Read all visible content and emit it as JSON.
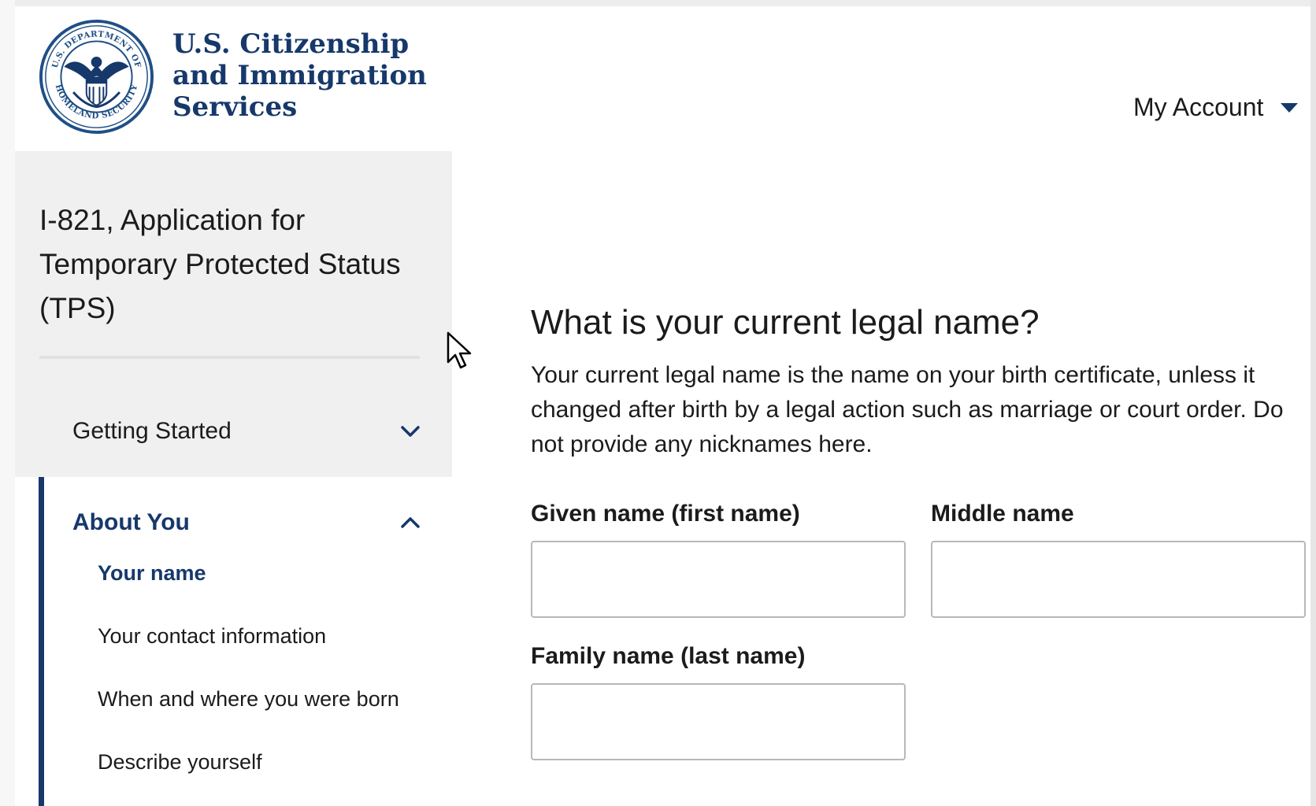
{
  "header": {
    "agency_name_lines": [
      "U.S. Citizenship",
      "and Immigration",
      "Services"
    ],
    "seal_ring_text": "U.S. DEPARTMENT OF HOMELAND SECURITY",
    "account_label": "My Account"
  },
  "sidebar": {
    "form_title": "I-821, Application for Temporary Protected Status (TPS)",
    "sections": [
      {
        "label": "Getting Started",
        "expanded": false
      },
      {
        "label": "About You",
        "expanded": true
      }
    ],
    "about_you_items": [
      {
        "label": "Your name",
        "current": true
      },
      {
        "label": "Your contact information",
        "current": false
      },
      {
        "label": "When and where you were born",
        "current": false
      },
      {
        "label": "Describe yourself",
        "current": false
      }
    ]
  },
  "main": {
    "question_title": "What is your current legal name?",
    "question_description": "Your current legal name is the name on your birth certificate, unless it changed after birth by a legal action such as marriage or court order. Do not provide any nicknames here.",
    "fields": {
      "given_name": {
        "label": "Given name (first name)",
        "value": ""
      },
      "middle_name": {
        "label": "Middle name",
        "value": ""
      },
      "family_name": {
        "label": "Family name (last name)",
        "value": ""
      }
    }
  },
  "colors": {
    "brand_navy": "#16386b",
    "sidebar_bg": "#f0f0f0",
    "text": "#1b1b1b",
    "input_border": "#b8b8b8"
  },
  "icons": {
    "seal": "dhs-seal-icon",
    "account_caret": "caret-down-icon",
    "collapsed_section": "chevron-down-icon",
    "expanded_section": "chevron-up-icon",
    "pointer": "mouse-pointer-icon"
  }
}
